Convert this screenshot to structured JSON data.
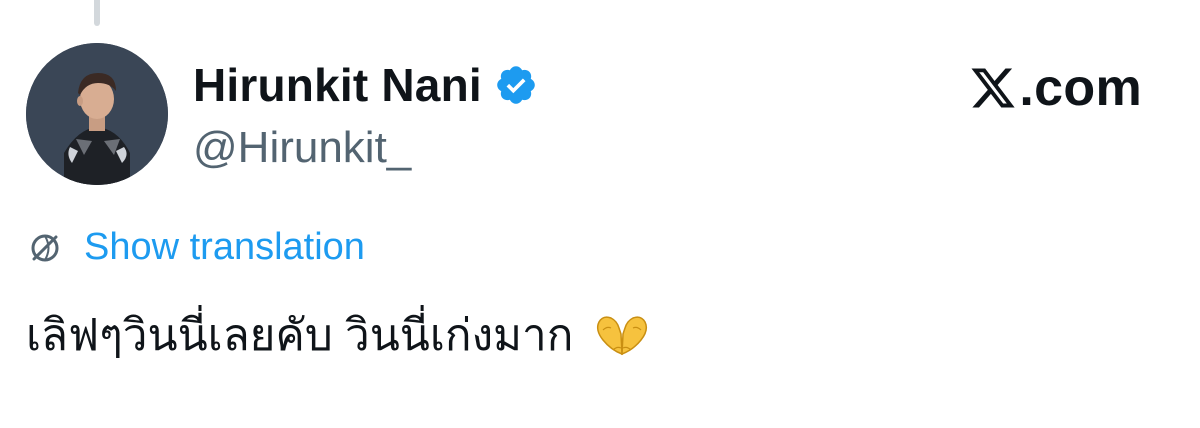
{
  "tweet": {
    "author": {
      "display_name": "Hirunkit Nani",
      "handle": "@Hirunkit_",
      "verified": true,
      "avatar_icon": "profile-photo"
    },
    "brand": {
      "logo_icon": "x-logo-icon",
      "suffix": ".com"
    },
    "translation": {
      "icon": "translate-globe-icon",
      "label": "Show translation"
    },
    "text": "เลิฟๆวินนี่เลยคับ วินนี่เก่งมาก",
    "emoji": "heart-hands-emoji"
  },
  "colors": {
    "link": "#1d9bf0",
    "verified": "#1d9bf0",
    "secondary_text": "#536471",
    "primary_text": "#0f1419",
    "emoji": "#f6c23e"
  }
}
